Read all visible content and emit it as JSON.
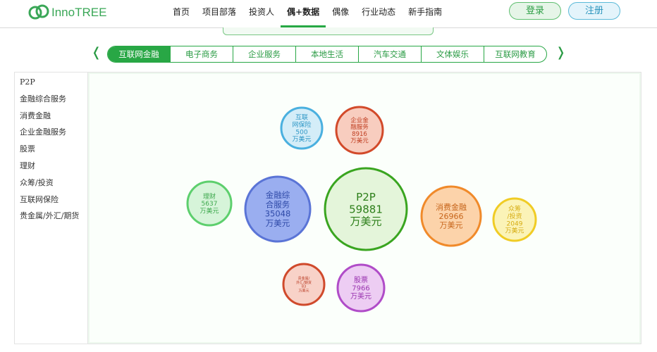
{
  "header": {
    "logo_text": "InnoTREE",
    "nav": [
      {
        "label": "首页",
        "active": false
      },
      {
        "label": "项目部落",
        "active": false
      },
      {
        "label": "投资人",
        "active": false
      },
      {
        "label": "偶+数据",
        "active": true
      },
      {
        "label": "偶像",
        "active": false
      },
      {
        "label": "行业动态",
        "active": false
      },
      {
        "label": "新手指南",
        "active": false
      }
    ],
    "login_label": "登录",
    "register_label": "注册"
  },
  "categories": {
    "prev_glyph": "❬",
    "next_glyph": "❭",
    "tabs": [
      {
        "label": "互联网金融",
        "active": true
      },
      {
        "label": "电子商务",
        "active": false
      },
      {
        "label": "企业服务",
        "active": false
      },
      {
        "label": "本地生活",
        "active": false
      },
      {
        "label": "汽车交通",
        "active": false
      },
      {
        "label": "文体娱乐",
        "active": false
      },
      {
        "label": "互联网教育",
        "active": false
      }
    ]
  },
  "sidebar": {
    "items": [
      "P2P",
      "金融综合服务",
      "消费金融",
      "企业金融服务",
      "股票",
      "理财",
      "众筹/投资",
      "互联网保险",
      "贵金属/外汇/期货"
    ]
  },
  "bubbles": {
    "unit": "万美元",
    "items": [
      {
        "lines": [
          "P2P"
        ],
        "value": 59881,
        "color": "#3aa520",
        "fill": "#e4f5da",
        "text_color": "#2d7f1a"
      },
      {
        "lines": [
          "金融综",
          "合服务"
        ],
        "value": 35048,
        "color": "#5a74d6",
        "fill": "#9aaef0",
        "text_color": "#2f4aa8"
      },
      {
        "lines": [
          "消费金融"
        ],
        "value": 26966,
        "color": "#f08a2a",
        "fill": "#fcd3aa",
        "text_color": "#c7661c"
      },
      {
        "lines": [
          "企业金",
          "融服务"
        ],
        "value": 8916,
        "color": "#d24a2a",
        "fill": "#f8cdbf",
        "text_color": "#c03f22"
      },
      {
        "lines": [
          "股票"
        ],
        "value": 7966,
        "color": "#b04cc8",
        "fill": "#edcdf3",
        "text_color": "#9a35b0"
      },
      {
        "lines": [
          "理财"
        ],
        "value": 5637,
        "color": "#5dcf6d",
        "fill": "#d6f4d9",
        "text_color": "#3ea94e"
      },
      {
        "lines": [
          "众筹",
          "/投资"
        ],
        "value": 2049,
        "color": "#f0cc25",
        "fill": "#fbf3b7",
        "text_color": "#d6ac12"
      },
      {
        "lines": [
          "互联",
          "网保险"
        ],
        "value": 500,
        "color": "#4ab0df",
        "fill": "#d4edf8",
        "text_color": "#2e97c6"
      },
      {
        "lines": [
          "贵金属/",
          "外汇/期货"
        ],
        "value": 83,
        "color": "#d04a2c",
        "fill": "#f8d2c8",
        "text_color": "#b83a22"
      }
    ]
  }
}
